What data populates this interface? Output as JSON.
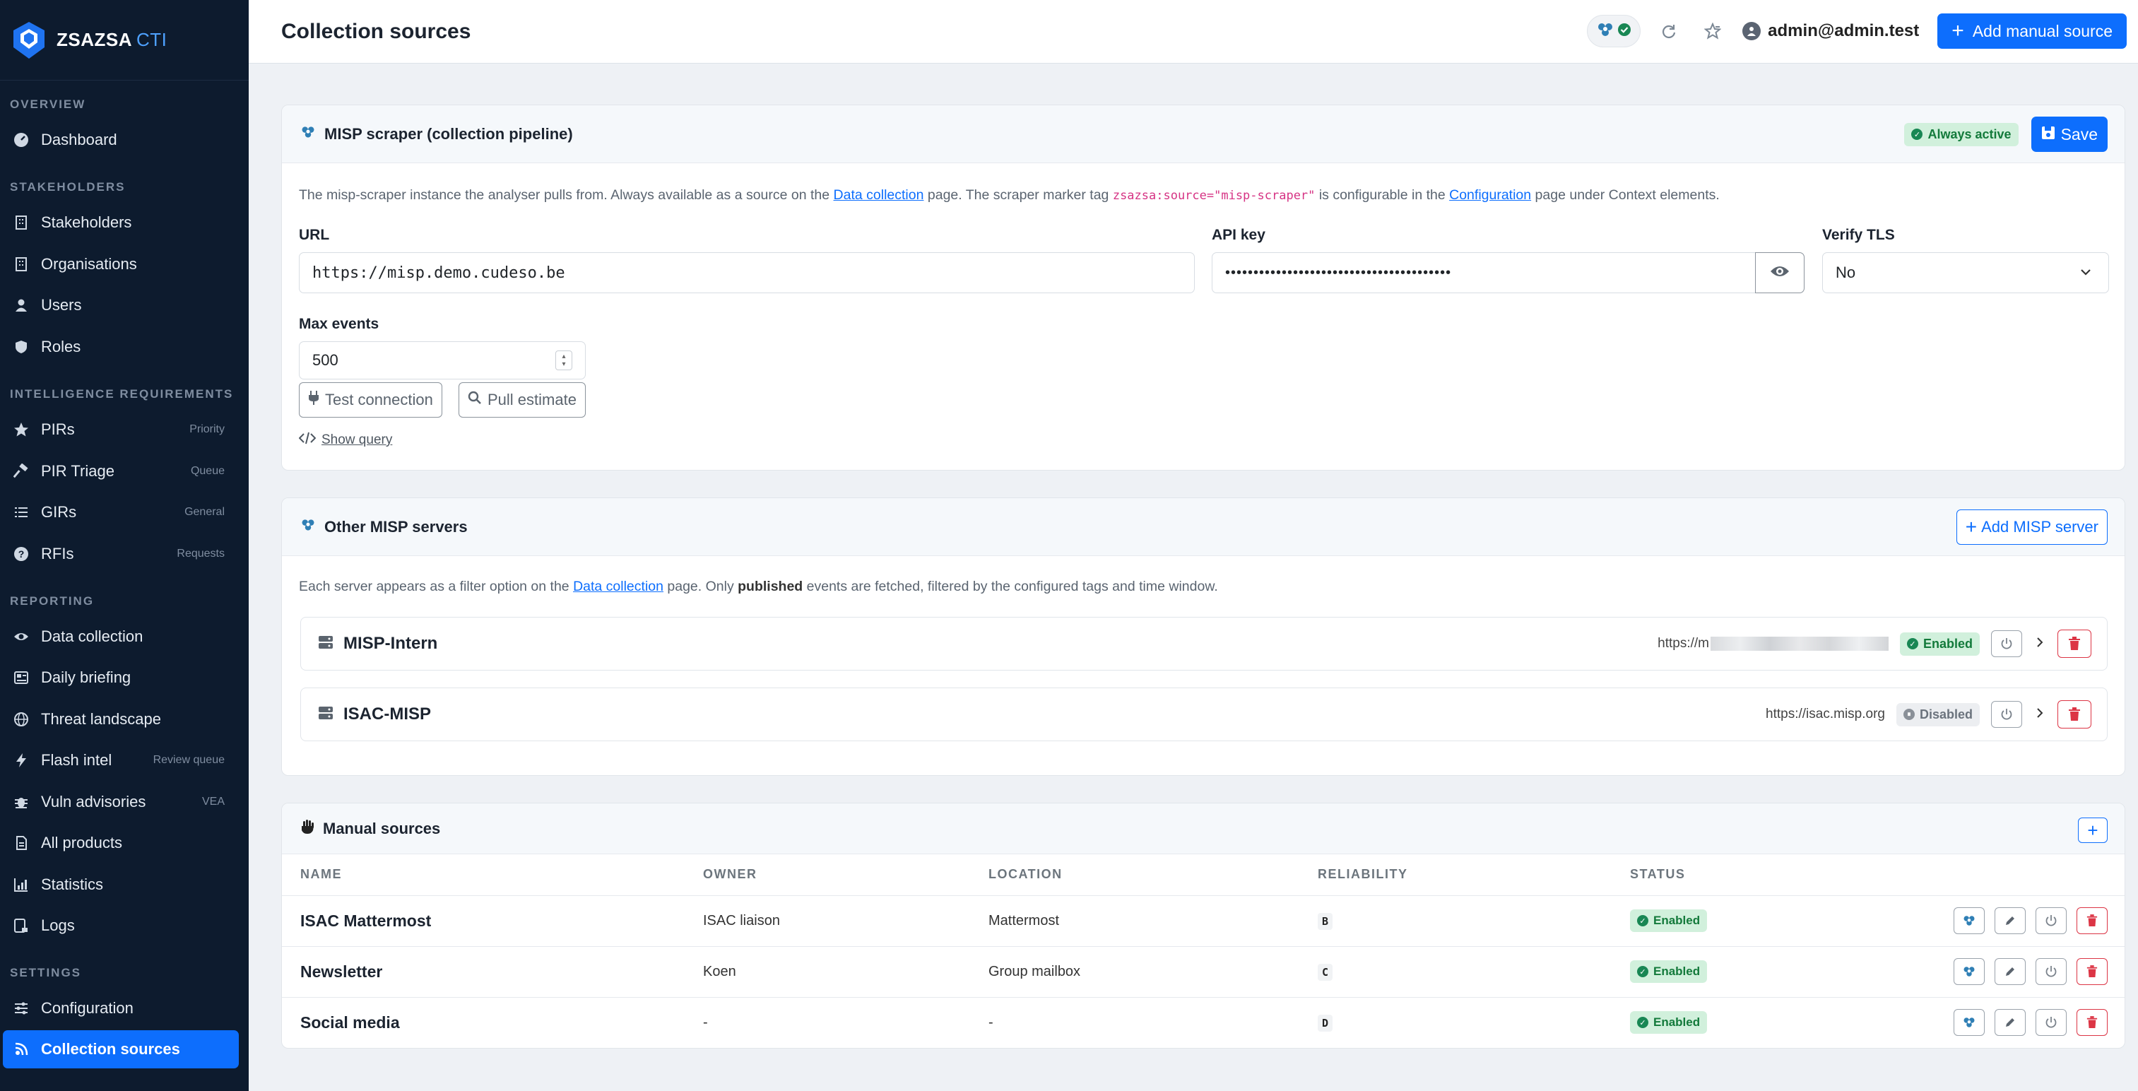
{
  "brand": {
    "name": "ZSAZSA",
    "suffix": "CTI"
  },
  "sidebar": {
    "sections": [
      "OVERVIEW",
      "STAKEHOLDERS",
      "INTELLIGENCE REQUIREMENTS",
      "REPORTING",
      "SETTINGS"
    ],
    "items": [
      {
        "label": "Dashboard",
        "icon": "gauge-icon"
      },
      {
        "label": "Stakeholders",
        "icon": "building-icon"
      },
      {
        "label": "Organisations",
        "icon": "building-icon"
      },
      {
        "label": "Users",
        "icon": "user-icon"
      },
      {
        "label": "Roles",
        "icon": "shield-icon"
      },
      {
        "label": "PIRs",
        "icon": "star-icon",
        "hint": "Priority"
      },
      {
        "label": "PIR Triage",
        "icon": "hammer-icon",
        "hint": "Queue"
      },
      {
        "label": "GIRs",
        "icon": "list-icon",
        "hint": "General"
      },
      {
        "label": "RFIs",
        "icon": "question-icon",
        "hint": "Requests"
      },
      {
        "label": "Data collection",
        "icon": "eye-icon"
      },
      {
        "label": "Daily briefing",
        "icon": "newspaper-icon"
      },
      {
        "label": "Threat landscape",
        "icon": "globe-icon"
      },
      {
        "label": "Flash intel",
        "icon": "lightning-icon",
        "hint": "Review queue"
      },
      {
        "label": "Vuln advisories",
        "icon": "bug-icon",
        "hint": "VEA"
      },
      {
        "label": "All products",
        "icon": "document-icon"
      },
      {
        "label": "Statistics",
        "icon": "chart-icon"
      },
      {
        "label": "Logs",
        "icon": "log-icon"
      },
      {
        "label": "Configuration",
        "icon": "sliders-icon"
      },
      {
        "label": "Collection sources",
        "icon": "broadcast-icon"
      }
    ]
  },
  "header": {
    "title": "Collection sources",
    "user": "admin@admin.test",
    "add_button": "Add manual source"
  },
  "misp_scraper": {
    "title": "MISP scraper (collection pipeline)",
    "badge": "Always active",
    "save": "Save",
    "desc_1": "The misp-scraper instance the analyser pulls from. Always available as a source on the",
    "desc_link_1": "Data collection",
    "desc_2": "page. The scraper marker tag",
    "desc_code": "zsazsa:source=\"misp-scraper\"",
    "desc_3": "is configurable in the",
    "desc_link_2": "Configuration",
    "desc_4": "page under Context elements.",
    "url_label": "URL",
    "url_value": "https://misp.demo.cudeso.be",
    "api_label": "API key",
    "api_value": "••••••••••••••••••••••••••••••••••••••••",
    "tls_label": "Verify TLS",
    "tls_value": "No",
    "max_label": "Max events",
    "max_value": "500",
    "test_btn": "Test connection",
    "pull_btn": "Pull estimate",
    "show_query": "Show query"
  },
  "other_misp": {
    "title": "Other MISP servers",
    "add_btn": "Add MISP server",
    "desc_1": "Each server appears as a filter option on the",
    "desc_link": "Data collection",
    "desc_2": "page. Only",
    "desc_bold": "published",
    "desc_3": "events are fetched, filtered by the configured tags and time window.",
    "servers": [
      {
        "name": "MISP-Intern",
        "url": "https://m",
        "status": "Enabled"
      },
      {
        "name": "ISAC-MISP",
        "url": "https://isac.misp.org",
        "status": "Disabled"
      }
    ]
  },
  "manual": {
    "title": "Manual sources",
    "columns": [
      "NAME",
      "OWNER",
      "LOCATION",
      "RELIABILITY",
      "STATUS"
    ],
    "rows": [
      {
        "name": "ISAC Mattermost",
        "owner": "ISAC liaison",
        "location": "Mattermost",
        "reliability": "B",
        "status": "Enabled"
      },
      {
        "name": "Newsletter",
        "owner": "Koen",
        "location": "Group mailbox",
        "reliability": "C",
        "status": "Enabled"
      },
      {
        "name": "Social media",
        "owner": "-",
        "location": "-",
        "reliability": "D",
        "status": "Enabled"
      }
    ]
  },
  "colors": {
    "primary": "#0d6efd",
    "sidebar": "#0d1b2e",
    "success": "#137a3b",
    "danger": "#dc3545"
  }
}
